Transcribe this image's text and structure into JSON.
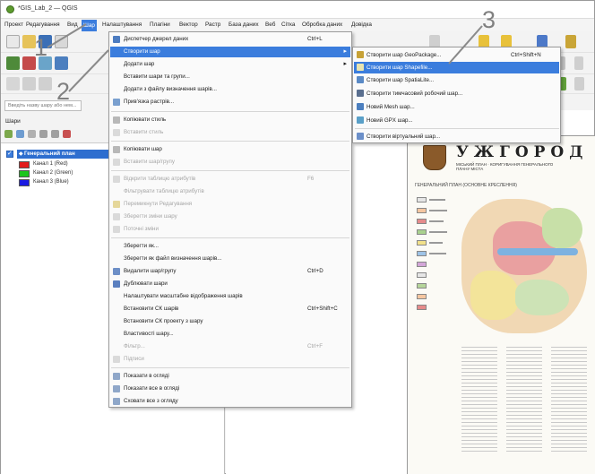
{
  "window": {
    "title": "*GIS_Lab_2 — QGIS"
  },
  "menubar": {
    "items": [
      {
        "label": "Проект"
      },
      {
        "label": "Редагування"
      },
      {
        "label": "Вид"
      },
      {
        "label": "Шар"
      },
      {
        "label": "Налаштування"
      },
      {
        "label": "Плагіни"
      },
      {
        "label": "Вектор"
      },
      {
        "label": "Растр"
      },
      {
        "label": "База даних"
      },
      {
        "label": "Веб"
      },
      {
        "label": "Сітка"
      },
      {
        "label": "Обробка даних"
      },
      {
        "label": "Довідка"
      }
    ]
  },
  "left_panel": {
    "search_placeholder": "Введіть назву шару або нем...",
    "header": "Шари",
    "layer_main": "Генеральний план",
    "bands": [
      {
        "label": "Канал 1 (Red)",
        "color": "#e21b1b"
      },
      {
        "label": "Канал 2 (Green)",
        "color": "#1bc41b"
      },
      {
        "label": "Канал 3 (Blue)",
        "color": "#1b1be2"
      }
    ]
  },
  "layer_menu": {
    "items": [
      {
        "label": "Диспетчер джерел даних",
        "shortcut": "Ctrl+L",
        "disabled": false,
        "icon": "data-source-icon"
      },
      {
        "label": "Створити шар",
        "shortcut": "",
        "disabled": false,
        "highlighted": true,
        "submenu": true
      },
      {
        "label": "Додати шар",
        "shortcut": "",
        "disabled": false,
        "submenu": true
      },
      {
        "label": "Вставити шари та групи...",
        "shortcut": "",
        "disabled": false
      },
      {
        "label": "Додати з файлу визначення шарів...",
        "shortcut": "",
        "disabled": false
      },
      {
        "label": "Прив'язка растрів...",
        "shortcut": "",
        "disabled": false,
        "icon": "georeferencer-icon"
      },
      {
        "label": "Копіювати стиль",
        "shortcut": "",
        "disabled": false,
        "icon": "copy-style-icon"
      },
      {
        "label": "Вставити стиль",
        "shortcut": "",
        "disabled": true,
        "icon": "paste-style-icon"
      },
      {
        "label": "Копіювати шар",
        "shortcut": "",
        "disabled": false,
        "icon": "copy-layer-icon"
      },
      {
        "label": "Вставити шар/групу",
        "shortcut": "",
        "disabled": true,
        "icon": "paste-layer-icon"
      },
      {
        "label": "Відкрити таблицю атрибутів",
        "shortcut": "F6",
        "disabled": true,
        "icon": "attribute-table-icon"
      },
      {
        "label": "Фільтрувати таблицю атрибутів",
        "shortcut": "",
        "disabled": true
      },
      {
        "label": "Перемикнути Редагування",
        "shortcut": "",
        "disabled": true,
        "icon": "edit-pencil-icon"
      },
      {
        "label": "Зберегти зміни шару",
        "shortcut": "",
        "disabled": true,
        "icon": "save-edits-icon"
      },
      {
        "label": "Поточні зміни",
        "shortcut": "",
        "disabled": true,
        "icon": "current-edits-icon"
      },
      {
        "label": "Зберегти як...",
        "shortcut": "",
        "disabled": false
      },
      {
        "label": "Зберегти як файл визначення шарів...",
        "shortcut": "",
        "disabled": false
      },
      {
        "label": "Видалити шар/групу",
        "shortcut": "Ctrl+D",
        "disabled": false,
        "icon": "remove-layer-icon"
      },
      {
        "label": "Дублювати шари",
        "shortcut": "",
        "disabled": false,
        "icon": "duplicate-layer-icon"
      },
      {
        "label": "Налаштувати масштабне відображення шарів",
        "shortcut": "",
        "disabled": false
      },
      {
        "label": "Встановити СК шарів",
        "shortcut": "Ctrl+Shift+C",
        "disabled": false
      },
      {
        "label": "Встановити СК проекту з шару",
        "shortcut": "",
        "disabled": false
      },
      {
        "label": "Властивості шару...",
        "shortcut": "",
        "disabled": false
      },
      {
        "label": "Фільтр...",
        "shortcut": "Ctrl+F",
        "disabled": true
      },
      {
        "label": "Підписи",
        "shortcut": "",
        "disabled": true,
        "icon": "labels-icon"
      },
      {
        "label": "Показати в огляді",
        "shortcut": "",
        "disabled": false,
        "icon": "overview-icon"
      },
      {
        "label": "Показати все в огляді",
        "shortcut": "",
        "disabled": false,
        "icon": "overview-all-icon"
      },
      {
        "label": "Сховати все з огляду",
        "shortcut": "",
        "disabled": false,
        "icon": "overview-hide-icon"
      }
    ]
  },
  "create_layer_submenu": {
    "items": [
      {
        "label": "Створити шар GeoPackage...",
        "shortcut": "Ctrl+Shift+N",
        "icon": "geopackage-icon"
      },
      {
        "label": "Створити шар Shapefile...",
        "shortcut": "",
        "highlighted": true,
        "icon": "shapefile-icon"
      },
      {
        "label": "Створити шар SpatiaLite...",
        "shortcut": "",
        "icon": "spatialite-icon"
      },
      {
        "label": "Створити тимчасовий робочий шар...",
        "shortcut": "",
        "icon": "temporary-layer-icon"
      },
      {
        "label": "Новий Mesh шар...",
        "shortcut": "",
        "icon": "mesh-icon"
      },
      {
        "label": "Новий GPX шар...",
        "shortcut": "",
        "icon": "gpx-icon"
      },
      {
        "label": "Створити віртуальний шар...",
        "shortcut": "",
        "icon": "virtual-layer-icon"
      }
    ]
  },
  "annotations": [
    "1",
    "2",
    "3"
  ],
  "map_preview": {
    "title": "УЖГОРОД",
    "subtitle": "МІСЬКИЙ ПЛАН · КОРИГУВАННЯ ГЕНЕРАЛЬНОГО ПЛАНУ МІСТА",
    "subtitle2": "ГЕНЕРАЛЬНИЙ ПЛАН (ОСНОВНЕ КРЕСЛЕННЯ)"
  }
}
